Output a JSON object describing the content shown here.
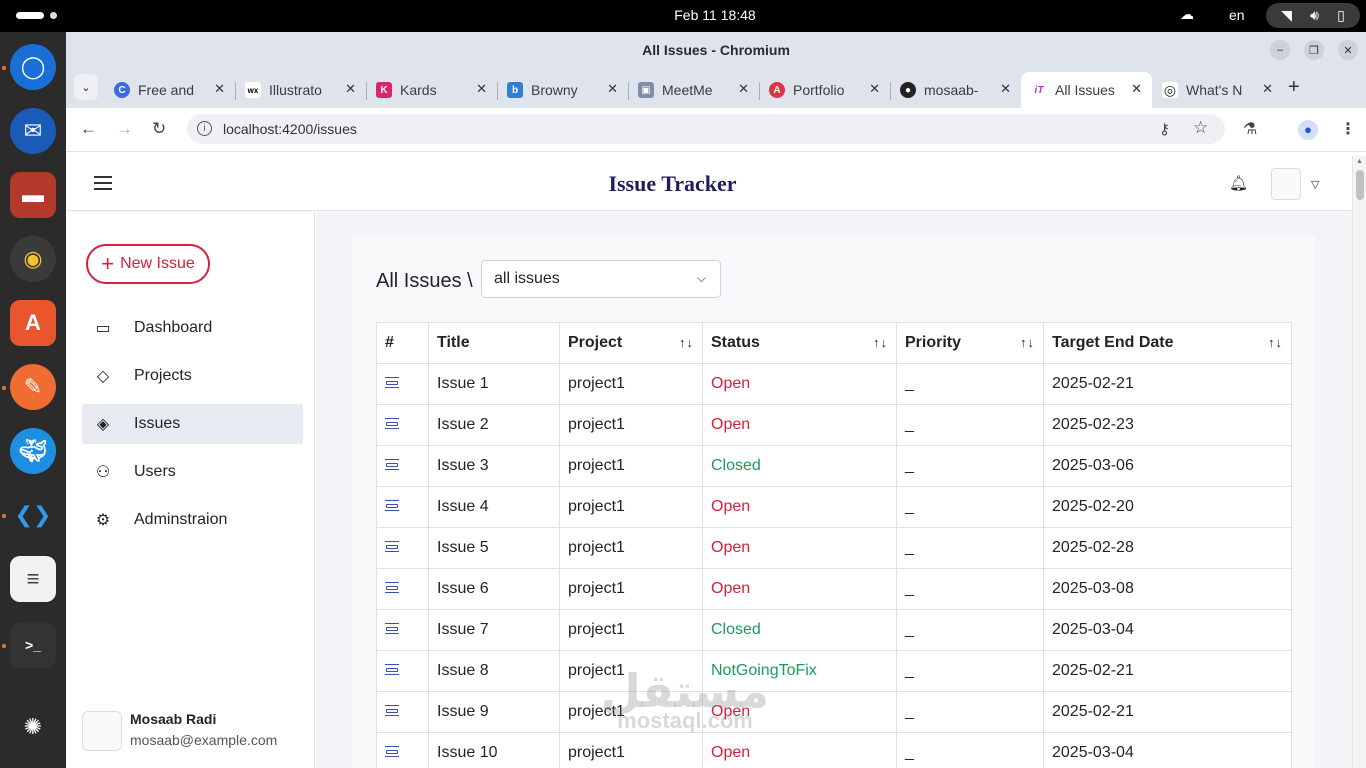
{
  "topbar": {
    "clock": "Feb 11  18:48",
    "lang": "en"
  },
  "browser": {
    "window_title": "All Issues - Chromium",
    "tabs": [
      {
        "label": "Free and",
        "fav_color": "#3b6bdc",
        "fav_text": "C"
      },
      {
        "label": "Illustrato",
        "fav_color": "#ffffff",
        "fav_text": "wx"
      },
      {
        "label": "Kards",
        "fav_color": "#e0246c",
        "fav_text": "K"
      },
      {
        "label": "Browny",
        "fav_color": "#2f7fd1",
        "fav_text": "b"
      },
      {
        "label": "MeetMe",
        "fav_color": "#7f8caa",
        "fav_text": "▣"
      },
      {
        "label": "Portfolio",
        "fav_color": "#dd3344",
        "fav_text": "A"
      },
      {
        "label": "mosaab-",
        "fav_color": "#222222",
        "fav_text": "●"
      },
      {
        "label": "All Issues",
        "fav_color": "#c42bd0",
        "fav_text": "iT"
      },
      {
        "label": "What's N",
        "fav_color": "#333333",
        "fav_text": "◎"
      }
    ],
    "url": "localhost:4200/issues"
  },
  "app": {
    "title": "Issue Tracker",
    "new_issue_label": "New Issue",
    "nav": [
      {
        "label": "Dashboard",
        "icon": "dashboard-icon"
      },
      {
        "label": "Projects",
        "icon": "layers-icon"
      },
      {
        "label": "Issues",
        "icon": "warning-diamond-icon"
      },
      {
        "label": "Users",
        "icon": "users-icon"
      },
      {
        "label": "Adminstraion",
        "icon": "admin-gear-icon"
      }
    ],
    "active_nav": "Issues",
    "profile": {
      "name": "Mosaab Radi",
      "email": "mosaab@example.com"
    }
  },
  "issues": {
    "breadcrumb": "All Issues \\",
    "filter_value": "all issues",
    "columns": [
      "#",
      "Title",
      "Project",
      "Status",
      "Priority",
      "Target End Date"
    ],
    "sort_glyph": "↑↓",
    "rows": [
      {
        "title": "Issue 1",
        "project": "project1",
        "status": "Open",
        "priority": "_",
        "target": "2025-02-21"
      },
      {
        "title": "Issue 2",
        "project": "project1",
        "status": "Open",
        "priority": "_",
        "target": "2025-02-23"
      },
      {
        "title": "Issue 3",
        "project": "project1",
        "status": "Closed",
        "priority": "_",
        "target": "2025-03-06"
      },
      {
        "title": "Issue 4",
        "project": "project1",
        "status": "Open",
        "priority": "_",
        "target": "2025-02-20"
      },
      {
        "title": "Issue 5",
        "project": "project1",
        "status": "Open",
        "priority": "_",
        "target": "2025-02-28"
      },
      {
        "title": "Issue 6",
        "project": "project1",
        "status": "Open",
        "priority": "_",
        "target": "2025-03-08"
      },
      {
        "title": "Issue 7",
        "project": "project1",
        "status": "Closed",
        "priority": "_",
        "target": "2025-03-04"
      },
      {
        "title": "Issue 8",
        "project": "project1",
        "status": "NotGoingToFix",
        "priority": "_",
        "target": "2025-02-21"
      },
      {
        "title": "Issue 9",
        "project": "project1",
        "status": "Open",
        "priority": "_",
        "target": "2025-02-21"
      },
      {
        "title": "Issue 10",
        "project": "project1",
        "status": "Open",
        "priority": "_",
        "target": "2025-03-04"
      }
    ],
    "status_colors": {
      "Open": "#d4213d",
      "Closed": "#1e9b5a",
      "NotGoingToFix": "#1e9b5a"
    }
  },
  "watermark": {
    "arabic": "مستقل",
    "latin": "mostaql.com"
  }
}
